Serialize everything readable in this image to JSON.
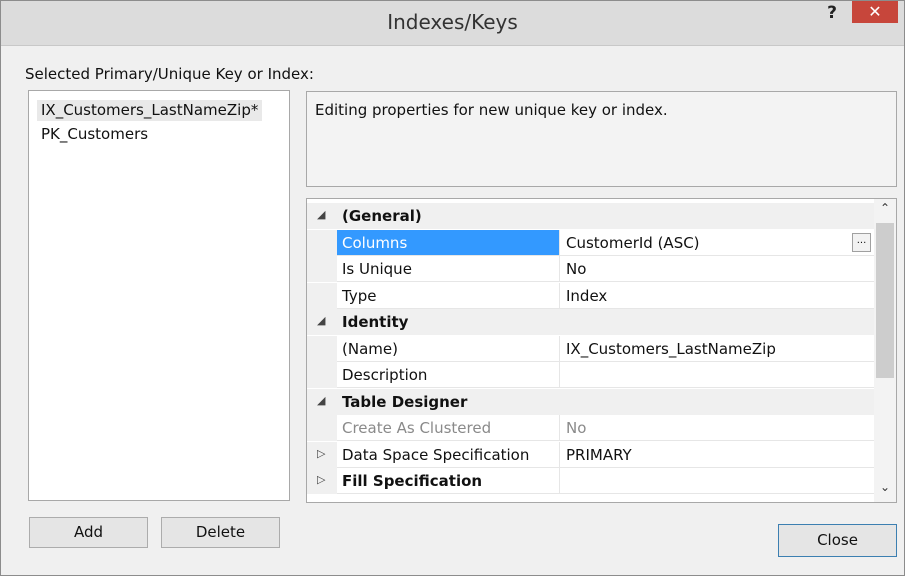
{
  "window": {
    "title": "Indexes/Keys",
    "help": "?",
    "close_glyph": "✕"
  },
  "key_list": {
    "label": "Selected Primary/Unique Key or Index:",
    "items": [
      {
        "label": "IX_Customers_LastNameZip*",
        "selected": true
      },
      {
        "label": "PK_Customers",
        "selected": false
      }
    ]
  },
  "buttons": {
    "add": "Add",
    "delete": "Delete",
    "close": "Close"
  },
  "description": "Editing properties for new unique key or index.",
  "property_grid": {
    "rows": [
      {
        "type": "category",
        "expander": "◢",
        "name": "(General)"
      },
      {
        "type": "property",
        "name": "Columns",
        "value": "CustomerId (ASC)",
        "selected": true,
        "ellipsis": "..."
      },
      {
        "type": "property",
        "name": "Is Unique",
        "value": "No"
      },
      {
        "type": "property",
        "name": "Type",
        "value": "Index"
      },
      {
        "type": "category",
        "expander": "◢",
        "name": "Identity"
      },
      {
        "type": "property",
        "name": "(Name)",
        "value": "IX_Customers_LastNameZip"
      },
      {
        "type": "property",
        "name": "Description",
        "value": ""
      },
      {
        "type": "category",
        "expander": "◢",
        "name": "Table Designer"
      },
      {
        "type": "property",
        "name": "Create As Clustered",
        "value": "No",
        "disabled": true
      },
      {
        "type": "property",
        "name": "Data Space Specification",
        "value": "PRIMARY",
        "expander": "▷"
      },
      {
        "type": "property",
        "name": "Fill Specification",
        "value": "",
        "expander": "▷",
        "bold": true
      }
    ],
    "scroll_up": "⌃",
    "scroll_down": "⌄"
  },
  "colors": {
    "selection": "#3399ff",
    "close_button": "#c7463b"
  }
}
